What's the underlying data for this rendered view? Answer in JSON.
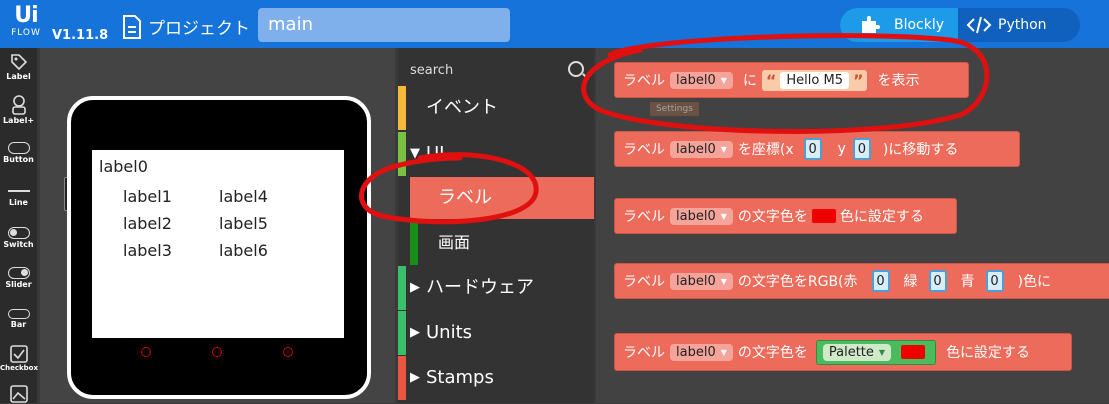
{
  "header": {
    "logo_top": "Ui",
    "logo_bottom": "FLOW",
    "version": "V1.11.8",
    "project_label": "プロジェクト",
    "filename": "main",
    "mode_blockly": "Blockly",
    "mode_python": "Python"
  },
  "palette": {
    "items": [
      {
        "label": "Label"
      },
      {
        "label": "Label+"
      },
      {
        "label": "Button"
      },
      {
        "label": "Line"
      },
      {
        "label": "Switch"
      },
      {
        "label": "Slider"
      },
      {
        "label": "Bar"
      },
      {
        "label": "Checkbox"
      }
    ]
  },
  "device": {
    "labels": [
      "label0",
      "label1",
      "label4",
      "label2",
      "label5",
      "label3",
      "label6"
    ]
  },
  "categories": {
    "search_placeholder": "search",
    "items": [
      {
        "label": "イベント",
        "color": "#f5b83d"
      },
      {
        "label": "UI",
        "color": "#7ac143"
      },
      {
        "label": "ラベル",
        "color": "#ec6b5b"
      },
      {
        "label": "画面",
        "color": "#1a8d1a"
      },
      {
        "label": "ハードウェア",
        "color": "#3cbf6b"
      },
      {
        "label": "Units",
        "color": "#3cbf6b"
      },
      {
        "label": "Stamps",
        "color": "#e8573f"
      }
    ],
    "arrow_expanded": "▼",
    "arrow_collapsed": "▶"
  },
  "blocks": {
    "b1": {
      "t1": "ラベル",
      "dd": "label0",
      "t2": "に",
      "str": "Hello M5",
      "t3": "を表示"
    },
    "b2": {
      "t1": "ラベル",
      "dd": "label0",
      "t2": "を座標(x",
      "x": "0",
      "t3": "y",
      "y": "0",
      "t4": ")に移動する"
    },
    "b3": {
      "t1": "ラベル",
      "dd": "label0",
      "t2": "の文字色を",
      "t3": "色に設定する"
    },
    "b4": {
      "t1": "ラベル",
      "dd": "label0",
      "t2": "の文字色をRGB(赤",
      "r": "0",
      "t3": "緑",
      "g": "0",
      "t4": "青",
      "b": "0",
      "t5": ")色に"
    },
    "b5": {
      "t1": "ラベル",
      "dd": "label0",
      "t2": "の文字色を",
      "pal": "Palette",
      "t3": "色に設定する"
    },
    "tooltip": "Settings"
  },
  "colors": {
    "header": "#1573d9",
    "block": "#ec6b5b",
    "annotation": "#e01010"
  }
}
